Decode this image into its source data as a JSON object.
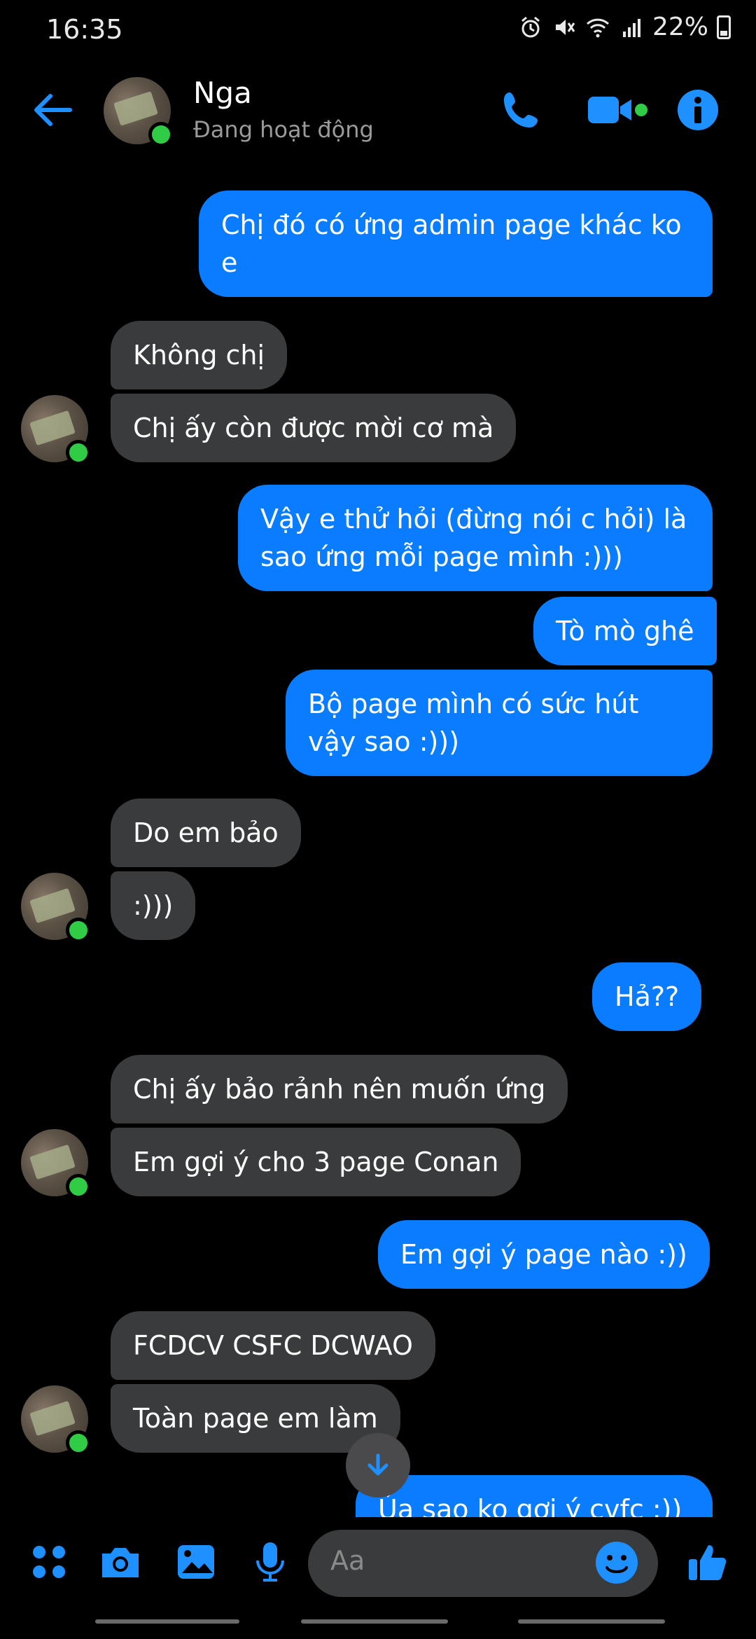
{
  "status_bar": {
    "time": "16:35",
    "battery": "22%"
  },
  "header": {
    "name": "Nga",
    "status": "Đang hoạt động"
  },
  "messages": [
    {
      "dir": "out",
      "text": "Chị đó có ứng admin page khác ko e"
    },
    {
      "dir": "in",
      "text": "Không chị"
    },
    {
      "dir": "in",
      "text": "Chị ấy còn được mời cơ mà"
    },
    {
      "dir": "out",
      "text": "Vậy e thử hỏi (đừng nói c hỏi) là sao ứng mỗi page mình :)))"
    },
    {
      "dir": "out",
      "text": "Tò mò ghê"
    },
    {
      "dir": "out",
      "text": "Bộ page mình có sức hút vậy sao :)))"
    },
    {
      "dir": "in",
      "text": "Do em bảo"
    },
    {
      "dir": "in",
      "text": ":)))"
    },
    {
      "dir": "out",
      "text": "Hả??"
    },
    {
      "dir": "in",
      "text": "Chị ấy bảo rảnh nên muốn ứng"
    },
    {
      "dir": "in",
      "text": "Em gợi ý cho 3 page Conan"
    },
    {
      "dir": "out",
      "text": "Em gợi ý page nào :))"
    },
    {
      "dir": "in",
      "text": "FCDCV CSFC DCWAO"
    },
    {
      "dir": "in",
      "text": "Toàn page em làm"
    },
    {
      "dir": "out",
      "text": "Ủa sao ko gợi ý cvfc :))"
    }
  ],
  "composer": {
    "placeholder": "Aa"
  },
  "colors": {
    "accent": "#0a7cff",
    "incoming": "#3a3b3c",
    "online": "#31cc46"
  }
}
